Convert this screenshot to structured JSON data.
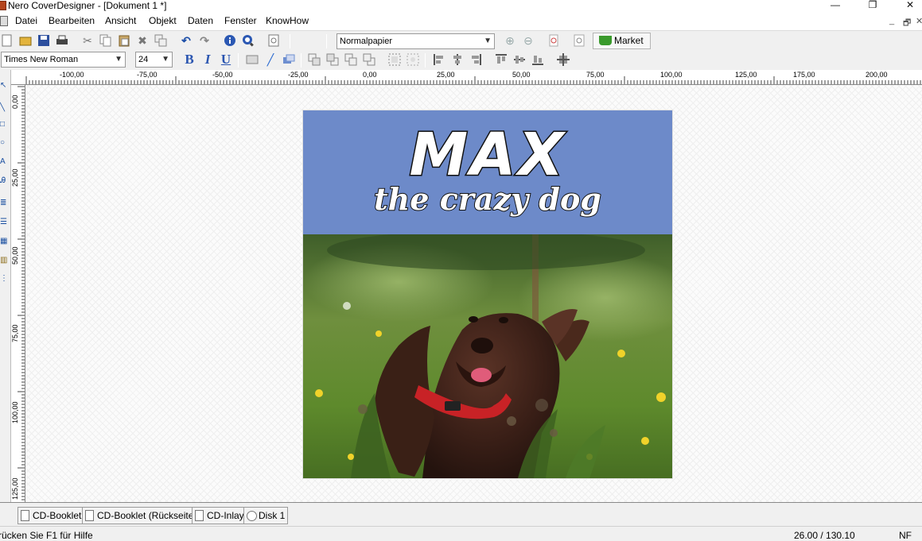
{
  "window": {
    "title": "Nero CoverDesigner - [Dokument 1 *]",
    "minimize": "—",
    "restore": "❐",
    "close": "✕",
    "mdi_min": "_",
    "mdi_restore": "🗗",
    "mdi_close": "✕"
  },
  "menu": [
    "Datei",
    "Bearbeiten",
    "Ansicht",
    "Objekt",
    "Daten",
    "Fenster",
    "KnowHow"
  ],
  "toolbar": {
    "paper_select": "Normalpapier",
    "market_label": "Market",
    "font_family": "Times New Roman",
    "font_size": "24",
    "bold": "B",
    "italic": "I",
    "underline": "U"
  },
  "ruler": {
    "top_labels": [
      "-100,00",
      "-75,00",
      "-50,00",
      "-25,00",
      "0,00",
      "25,00",
      "50,00",
      "75,00",
      "100,00",
      "125,00",
      "175,00",
      "200,00"
    ],
    "left_labels": [
      "0,00",
      "25,00",
      "50,00",
      "75,00",
      "100,00",
      "125,00"
    ]
  },
  "cover": {
    "title": "MAX",
    "subtitle": "the crazy dog",
    "banner_color": "#6d8ac9"
  },
  "tabs": [
    {
      "label": "CD-Booklet",
      "icon": "page-icon"
    },
    {
      "label": "CD-Booklet (Rückseite)",
      "icon": "page-icon"
    },
    {
      "label": "CD-Inlay",
      "icon": "page-icon"
    },
    {
      "label": "Disk 1",
      "icon": "disc-icon"
    }
  ],
  "status": {
    "help": "rücken Sie F1 für Hilfe",
    "coords": "26.00 / 130.10",
    "mode": "NF"
  }
}
